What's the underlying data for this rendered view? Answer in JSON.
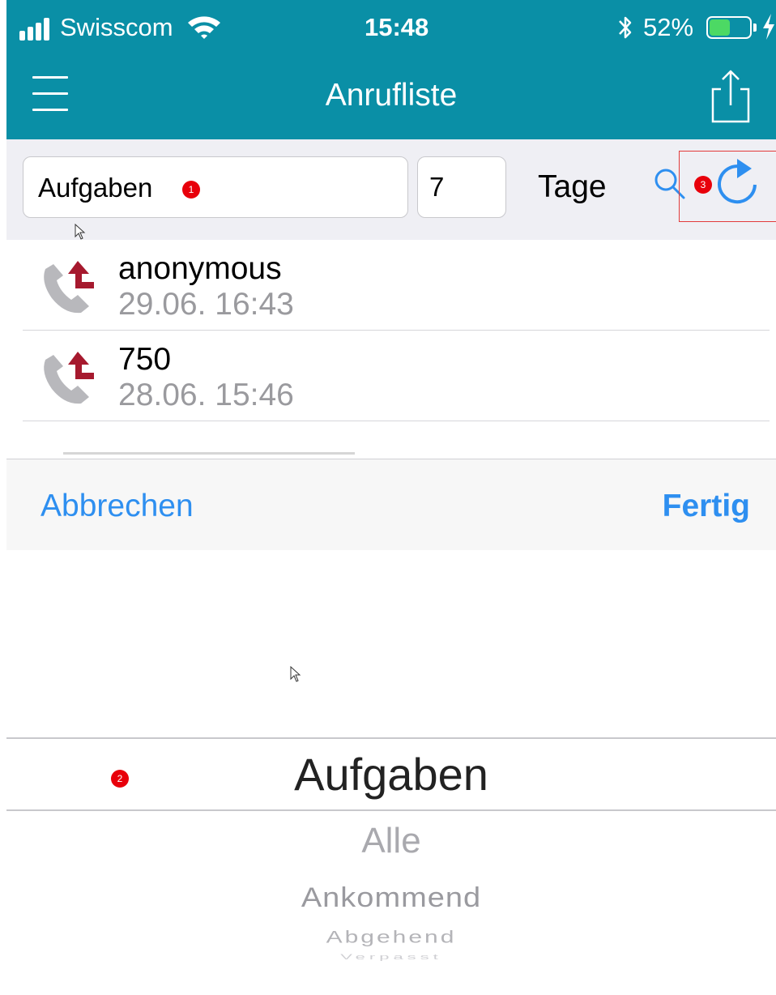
{
  "status_bar": {
    "carrier": "Swisscom",
    "time": "15:48",
    "battery_percent": "52%",
    "battery_level": 0.52,
    "icons": [
      "signal-icon",
      "wifi-icon",
      "bluetooth-icon",
      "battery-icon",
      "charging-bolt-icon"
    ]
  },
  "nav": {
    "title": "Anrufliste",
    "left_icon": "hamburger-menu-icon",
    "right_icon": "share-icon"
  },
  "filter": {
    "category": "Aufgaben",
    "days": "7",
    "days_unit": "Tage",
    "annotations": {
      "category_badge": "1",
      "picker_badge": "2",
      "refresh_badge": "3"
    },
    "search_icon": "search-icon",
    "refresh_icon": "refresh-icon"
  },
  "calls": [
    {
      "name": "anonymous",
      "time": "29.06. 16:43",
      "icon": "outgoing-call-icon"
    },
    {
      "name": "750",
      "time": "28.06. 15:46",
      "icon": "outgoing-call-icon"
    }
  ],
  "picker": {
    "cancel_label": "Abbrechen",
    "done_label": "Fertig",
    "selected": "Aufgaben",
    "options": [
      "Alle",
      "Ankommend",
      "Abgehend",
      "Verpasst"
    ]
  },
  "colors": {
    "header": "#0a8fa6",
    "accent": "#2e8ff0",
    "badge": "#e8000b",
    "call_arrow": "#a6192e",
    "battery_fill": "#4cd964"
  }
}
